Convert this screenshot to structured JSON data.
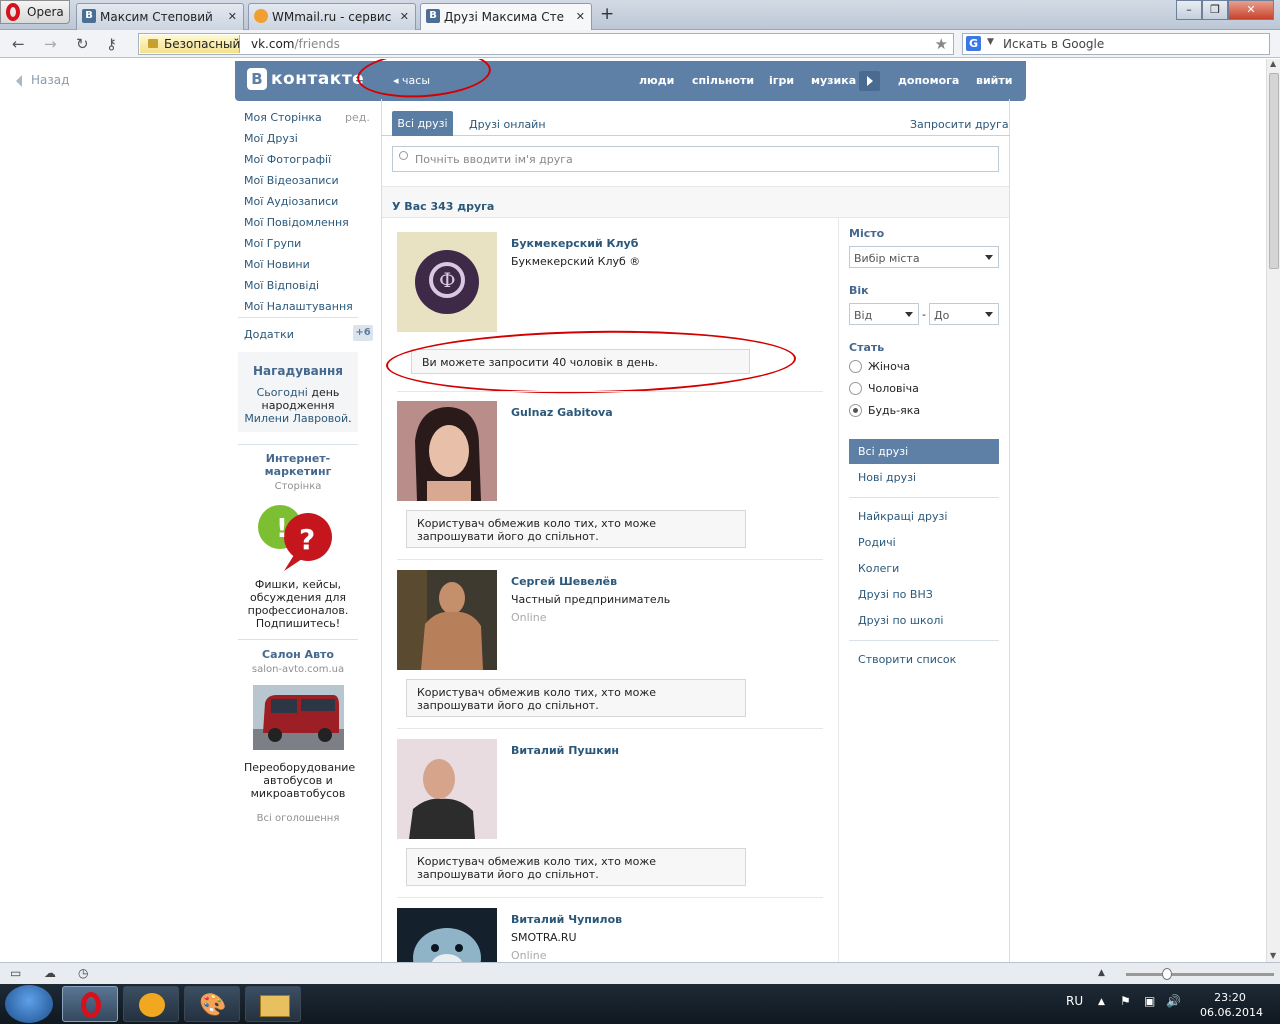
{
  "browser": {
    "menu_label": "Opera",
    "tabs": [
      {
        "icon": "В",
        "title": "Максим Степовий"
      },
      {
        "icon": "",
        "title": "WMmail.ru - сервис п..."
      },
      {
        "icon": "В",
        "title": "Друзі Максима Степо..."
      }
    ],
    "secure_label": "Безопасный",
    "url_host": "vk.com",
    "url_path": "/friends",
    "search_engine": "G",
    "search_placeholder": "Искать в Google"
  },
  "page": {
    "back_label": "Назад",
    "logo_icon": "В",
    "logo_text": "контакте",
    "header_back": "часы",
    "header_links": [
      "люди",
      "спільноти",
      "ігри",
      "музика",
      "допомога",
      "вийти"
    ]
  },
  "left_menu": {
    "items": [
      "Моя Сторінка",
      "Мої Друзі",
      "Мої Фотографії",
      "Мої Відеозаписи",
      "Мої Аудіозаписи",
      "Мої Повідомлення",
      "Мої Групи",
      "Мої Новини",
      "Мої Відповіді",
      "Мої Налаштування"
    ],
    "edit_label": "ред.",
    "apps_label": "Додатки",
    "apps_badge": "+6",
    "reminder": {
      "title": "Нагадування",
      "today": "Сьогодні",
      "text1": "день",
      "text2": "народження",
      "name": "Милени Лавровой",
      "period": "."
    },
    "ads": [
      {
        "title": "Интернет-маркетинг",
        "sub": "Сторінка",
        "text": "Фишки, кейсы, обсуждения для профессионалов. Подпишитесь!"
      },
      {
        "title": "Салон Авто",
        "sub": "salon-avto.com.ua",
        "text": "Переоборудование автобусов и микроавтобусов"
      }
    ],
    "all_ads": "Всі оголошення"
  },
  "friends": {
    "tab_all": "Всі друзі",
    "tab_online": "Друзі онлайн",
    "invite": "Запросити друга",
    "search_placeholder": "Почніть вводити ім'я друга",
    "count_label": "У Вас 343 друга",
    "invite_limit_note": "Ви можете запросити 40 чоловік в день.",
    "restricted_note": "Користувач обмежив коло тих, хто може запрошувати його до спільнот.",
    "list": [
      {
        "name": "Букмекерский Клуб",
        "sub": "Букмекерский Клуб ®",
        "status": ""
      },
      {
        "name": "Gulnaz Gabitova",
        "sub": "",
        "status": ""
      },
      {
        "name": "Сергей Шевелёв",
        "sub": "Частный предприниматель",
        "status": "Online"
      },
      {
        "name": "Виталий Пушкин",
        "sub": "",
        "status": ""
      },
      {
        "name": "Виталий Чупилов",
        "sub": "SMOTRA.RU",
        "status": "Online"
      }
    ]
  },
  "filters": {
    "city_label": "Місто",
    "city_value": "Вибір міста",
    "age_label": "Вік",
    "age_from": "Від",
    "age_dash": "-",
    "age_to": "До",
    "sex_label": "Стать",
    "sex_options": [
      "Жіноча",
      "Чоловіча",
      "Будь-яка"
    ],
    "sex_selected": "Будь-яка",
    "lists_active": "Всі друзі",
    "lists": [
      "Нові друзі",
      "Найкращі друзі",
      "Родичі",
      "Колеги",
      "Друзі по ВНЗ",
      "Друзі по школі",
      "Створити список"
    ]
  },
  "taskbar": {
    "lang": "RU",
    "time": "23:20",
    "date": "06.06.2014"
  },
  "colors": {
    "vk_blue": "#5e80a6",
    "link": "#2b587a",
    "annotation": "#d40000"
  }
}
